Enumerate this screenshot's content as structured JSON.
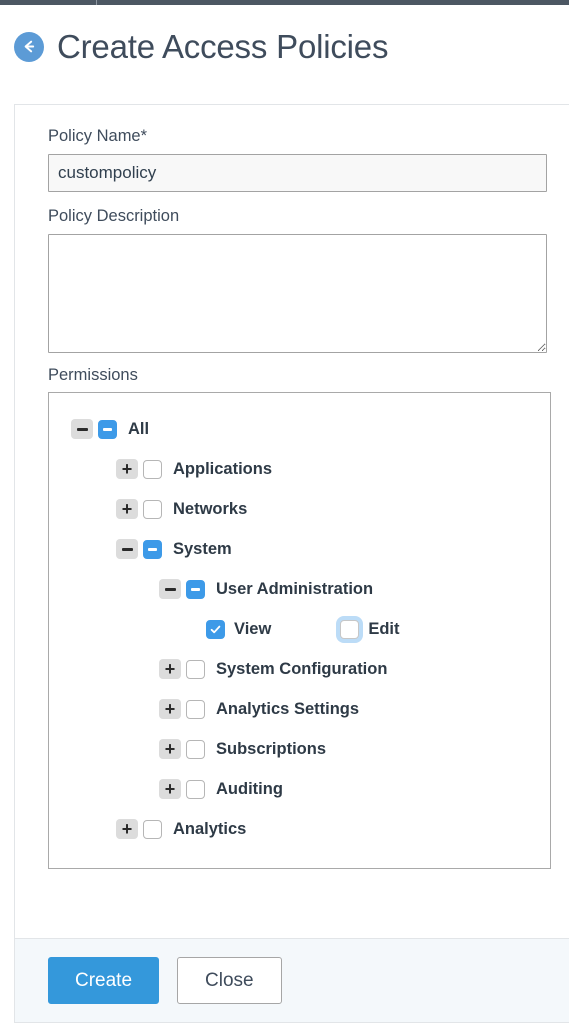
{
  "window": {
    "top_strip_color": "#4c5763"
  },
  "header": {
    "back_icon": "arrow-left-circle-icon",
    "title": "Create Access Policies",
    "accent_color": "#5c9bd6",
    "title_color": "#3f4c5c"
  },
  "form": {
    "policy_name": {
      "label": "Policy Name*",
      "value": "custompolicy",
      "placeholder": ""
    },
    "policy_description": {
      "label": "Policy Description",
      "value": "",
      "placeholder": ""
    },
    "permissions": {
      "label": "Permissions",
      "tree": [
        {
          "label": "All",
          "level": 0,
          "expander": "minus",
          "checkbox": "indeterminate"
        },
        {
          "label": "Applications",
          "level": 1,
          "expander": "plus",
          "checkbox": "unchecked"
        },
        {
          "label": "Networks",
          "level": 1,
          "expander": "plus",
          "checkbox": "unchecked"
        },
        {
          "label": "System",
          "level": 1,
          "expander": "minus",
          "checkbox": "indeterminate"
        },
        {
          "label": "User Administration",
          "level": 2,
          "expander": "minus",
          "checkbox": "indeterminate"
        },
        {
          "label": "View",
          "level": 3,
          "expander": "none",
          "checkbox": "checked",
          "sibling_label": "Edit",
          "sibling_checkbox": "focused"
        },
        {
          "label": "System Configuration",
          "level": 2,
          "expander": "plus",
          "checkbox": "unchecked"
        },
        {
          "label": "Analytics Settings",
          "level": 2,
          "expander": "plus",
          "checkbox": "unchecked"
        },
        {
          "label": "Subscriptions",
          "level": 2,
          "expander": "plus",
          "checkbox": "unchecked"
        },
        {
          "label": "Auditing",
          "level": 2,
          "expander": "plus",
          "checkbox": "unchecked"
        },
        {
          "label": "Analytics",
          "level": 1,
          "expander": "plus",
          "checkbox": "unchecked"
        }
      ]
    }
  },
  "footer": {
    "create_label": "Create",
    "close_label": "Close",
    "primary_color": "#3498db"
  }
}
